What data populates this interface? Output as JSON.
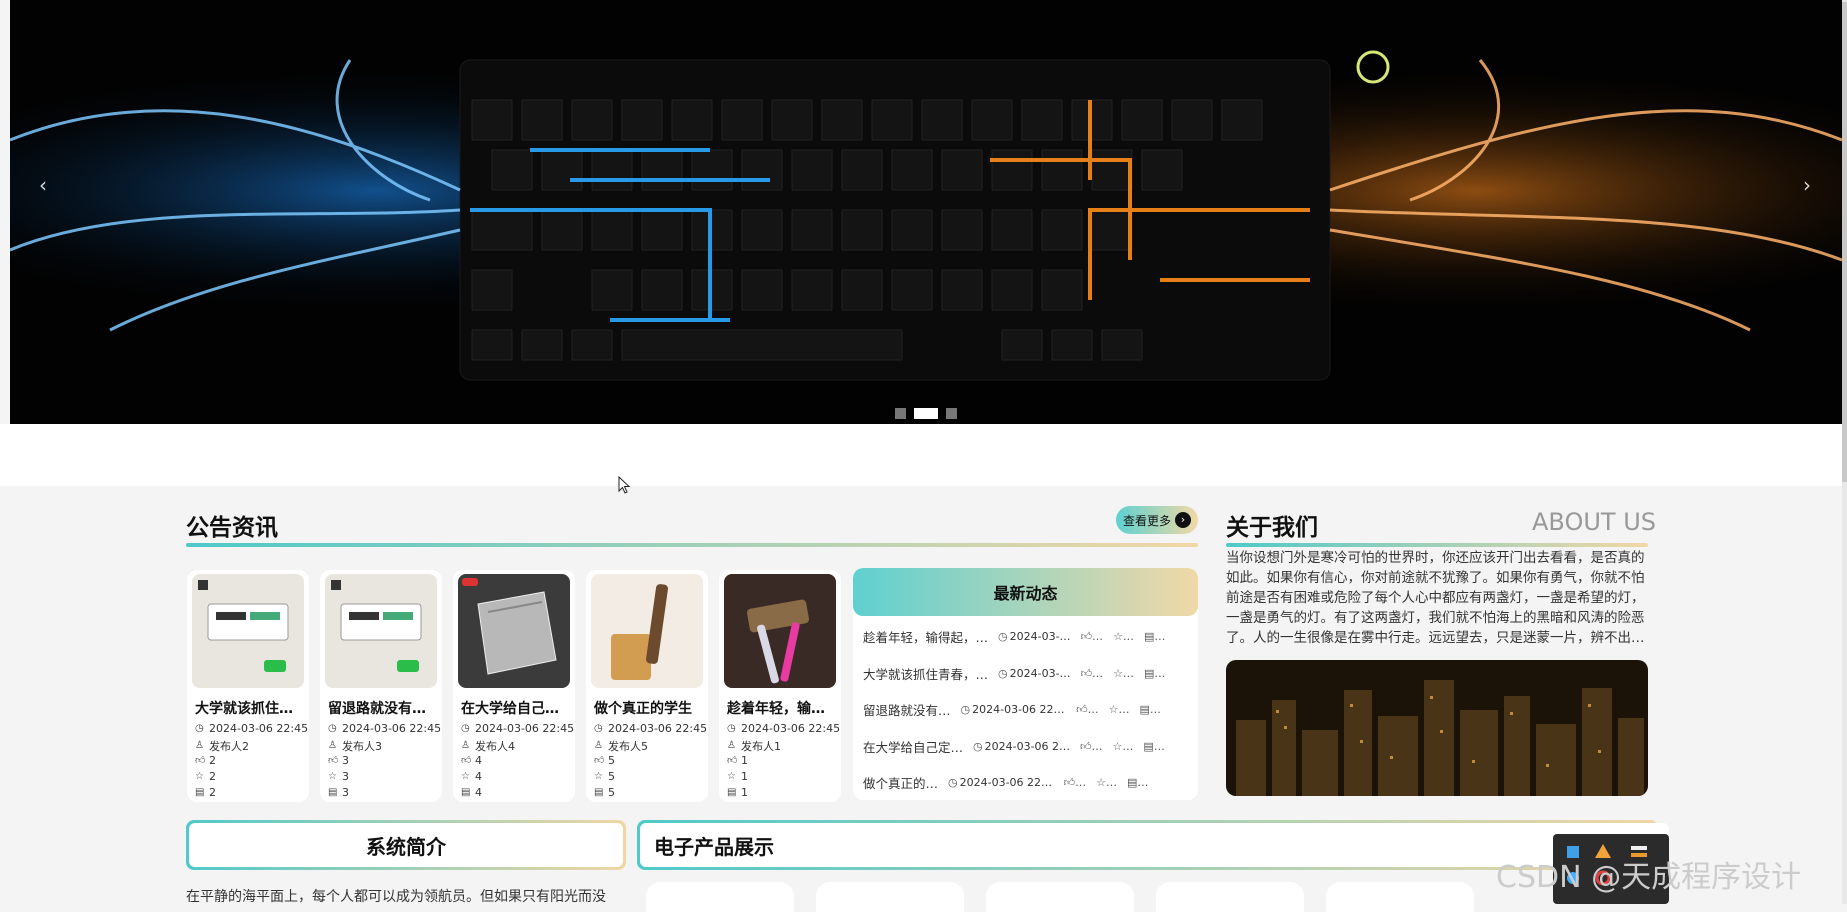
{
  "banner": {
    "prev": "‹",
    "next": "›",
    "slide_count": 3,
    "active_slide": 2
  },
  "notice": {
    "title": "公告资讯",
    "more": "查看更多",
    "more_icon": "arrow-right-circle-icon"
  },
  "cards": [
    {
      "title": "大学就该抓住…",
      "date": "2024-03-06 22:45",
      "author": "发布人2",
      "likes": "2",
      "favs": "2",
      "views": "2"
    },
    {
      "title": "留退路就没有…",
      "date": "2024-03-06 22:45",
      "author": "发布人3",
      "likes": "3",
      "favs": "3",
      "views": "3"
    },
    {
      "title": "在大学给自己…",
      "date": "2024-03-06 22:45",
      "author": "发布人4",
      "likes": "4",
      "favs": "4",
      "views": "4"
    },
    {
      "title": "做个真正的学生",
      "date": "2024-03-06 22:45",
      "author": "发布人5",
      "likes": "5",
      "favs": "5",
      "views": "5"
    },
    {
      "title": "趁着年轻，输…",
      "date": "2024-03-06 22:45",
      "author": "发布人1",
      "likes": "1",
      "favs": "1",
      "views": "1"
    }
  ],
  "news": {
    "title": "最新动态",
    "rows": [
      {
        "title": "趁着年轻，输得起，…",
        "date": "2024-03-…"
      },
      {
        "title": "大学就该抓住青春，…",
        "date": "2024-03-…"
      },
      {
        "title": "留退路就没有…",
        "date": "2024-03-06 22:…"
      },
      {
        "title": "在大学给自己定…",
        "date": "2024-03-06 2…"
      },
      {
        "title": "做个真正的…",
        "date": "2024-03-06 22:…"
      }
    ]
  },
  "about": {
    "title": "关于我们",
    "title_en": "ABOUT US",
    "text": "当你设想门外是寒冷可怕的世界时，你还应该开门出去看看，是否真的如此。如果你有信心，你对前途就不犹豫了。如果你有勇气，你就不怕前途是否有困难或危险了每个人心中都应有两盏灯，一盏是希望的灯，一盏是勇气的灯。有了这两盏灯，我们就不怕海上的黑暗和风涛的险恶了。人的一生很像是在雾中行走。远远望去，只是迷蒙一片，辨不出…"
  },
  "intro": {
    "title": "系统简介",
    "text": "在平静的海平面上，每个人都可以成为领航员。但如果只有阳光而没"
  },
  "products": {
    "title": "电子产品展示"
  },
  "watermark": "CSDN @天成程序设计",
  "colors": {
    "accent_teal": "#4fc9c9",
    "accent_gold": "#f0d6a4"
  }
}
